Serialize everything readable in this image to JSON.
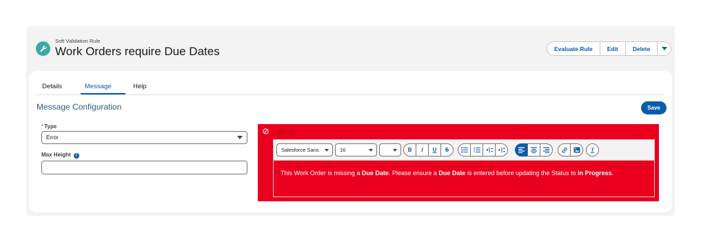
{
  "header": {
    "eyebrow": "Soft Validation Rule",
    "title": "Work Orders require Due Dates",
    "icon": "wrench-icon",
    "icon_color": "#3ba9a6",
    "buttons": {
      "evaluate": "Evaluate Rule",
      "edit": "Edit",
      "delete": "Delete"
    }
  },
  "tabs": [
    {
      "label": "Details"
    },
    {
      "label": "Message"
    },
    {
      "label": "Help"
    }
  ],
  "active_tab": "Message",
  "section": {
    "title": "Message Configuration",
    "save": "Save"
  },
  "form": {
    "type_required": "*",
    "type_label": "Type",
    "type_value": "Error",
    "max_height_label": "Max Height",
    "max_height_value": ""
  },
  "message": {
    "label": "Message",
    "panel_color": "#ea001e",
    "font": "Salesforce Sans",
    "size": "16",
    "color_value": "",
    "body": [
      {
        "text": "This Work Order is missing a ",
        "bold": false
      },
      {
        "text": "Due Date",
        "bold": true
      },
      {
        "text": ". Please ensure a ",
        "bold": false
      },
      {
        "text": "Due Date",
        "bold": true
      },
      {
        "text": " is entered before updating the Status to ",
        "bold": false
      },
      {
        "text": "In Progress",
        "bold": true
      },
      {
        "text": ".",
        "bold": false
      }
    ]
  },
  "toolbar": {
    "format": [
      "B",
      "I",
      "U",
      "S"
    ],
    "clear": "T"
  },
  "colors": {
    "brand": "#0b5cab",
    "error": "#ea001e"
  }
}
